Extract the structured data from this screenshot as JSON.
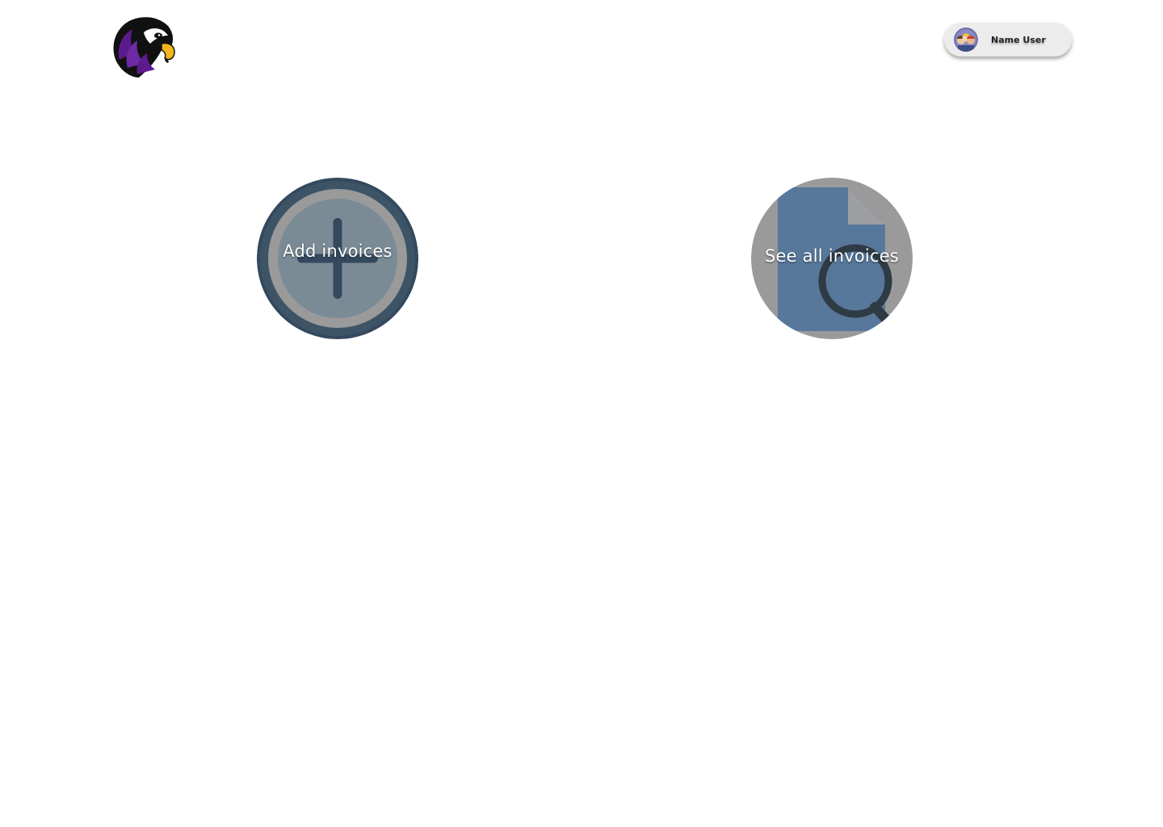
{
  "header": {
    "logo_icon": "falcon-mascot-logo",
    "user": {
      "name": "Name User",
      "avatar_icon": "user-avatar-icon"
    }
  },
  "actions": {
    "add": {
      "label": "Add invoices",
      "icon": "plus-circle-icon"
    },
    "see": {
      "label": "See all invoices",
      "icon": "document-search-icon"
    }
  },
  "colors": {
    "add_ring": "#34495e",
    "add_fill": "#7a8b96",
    "see_bg": "#9a9a9a",
    "see_doc": "#57789a",
    "logo_purple": "#5b1a8e",
    "logo_yellow": "#f2b61c"
  }
}
